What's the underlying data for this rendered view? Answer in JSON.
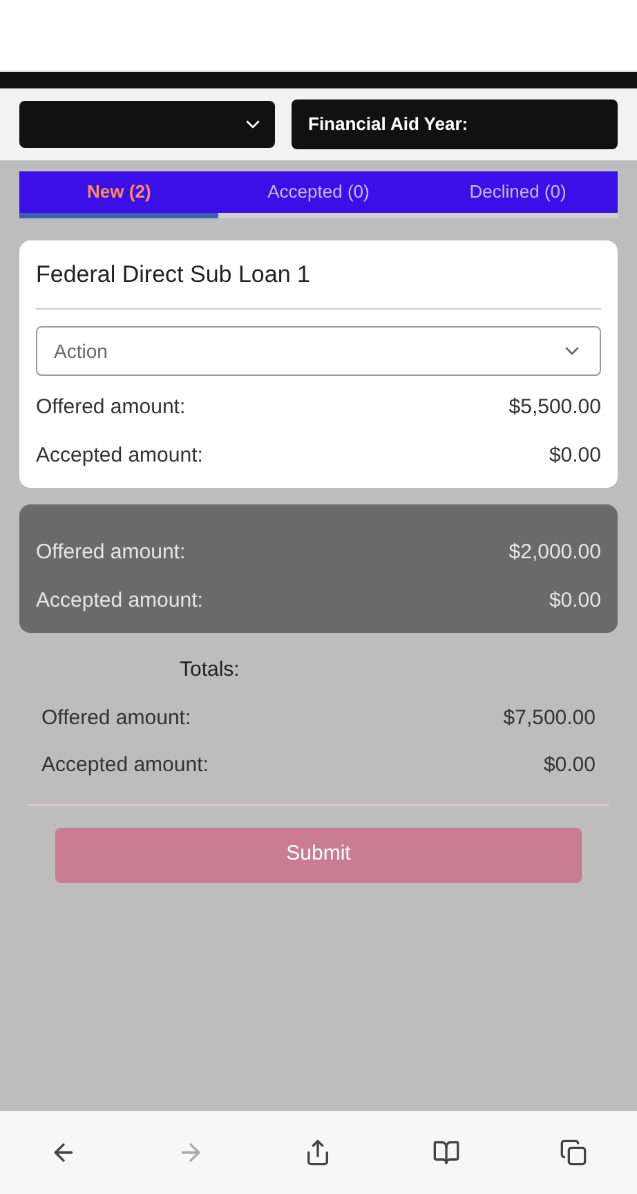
{
  "filter": {
    "label": "Financial Aid Year:"
  },
  "tabs": [
    {
      "label": "New (2)",
      "selected": true
    },
    {
      "label": "Accepted (0)",
      "selected": false
    },
    {
      "label": "Declined (0)",
      "selected": false
    }
  ],
  "awards": [
    {
      "title": "Federal Direct Sub Loan 1",
      "action_placeholder": "Action",
      "dimmed": false,
      "rows": [
        {
          "label": "Offered amount:",
          "value": "$5,500.00"
        },
        {
          "label": "Accepted amount:",
          "value": "$0.00"
        }
      ]
    },
    {
      "dimmed": true,
      "rows": [
        {
          "label": "Offered amount:",
          "value": "$2,000.00"
        },
        {
          "label": "Accepted amount:",
          "value": "$0.00"
        }
      ]
    }
  ],
  "totals": {
    "title": "Totals:",
    "rows": [
      {
        "label": "Offered amount:",
        "value": "$7,500.00"
      },
      {
        "label": "Accepted amount:",
        "value": "$0.00"
      }
    ]
  },
  "submit": {
    "label": "Submit",
    "disabled": true
  }
}
